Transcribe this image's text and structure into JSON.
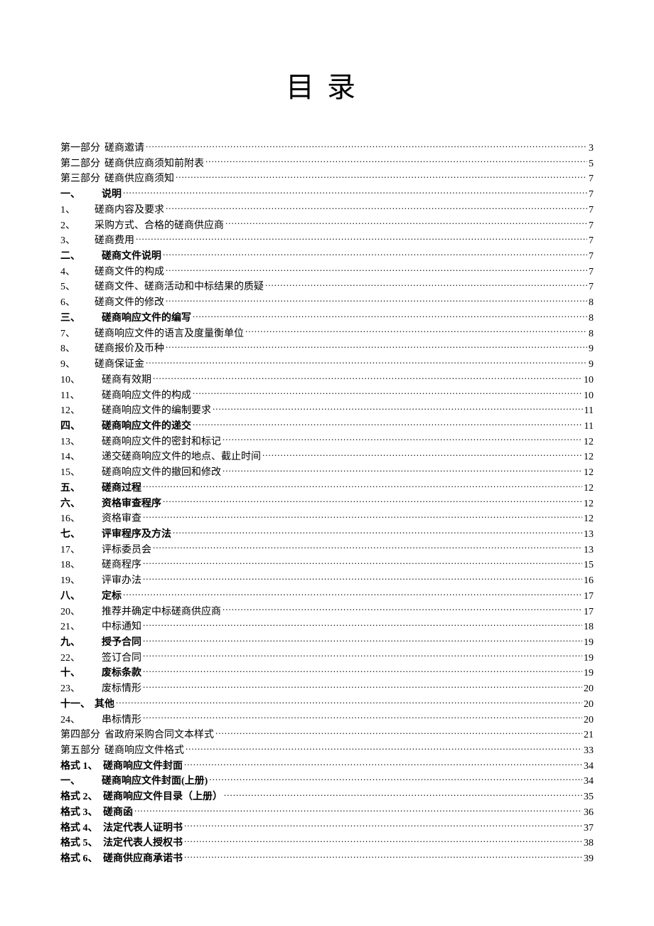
{
  "title": "目录",
  "entries": [
    {
      "num": "第一部分",
      "label": "磋商邀请",
      "page": "3",
      "boldLabel": false,
      "boldNum": false,
      "indent": false,
      "wide": true
    },
    {
      "num": "第二部分",
      "label": "磋商供应商须知前附表",
      "page": "5",
      "boldLabel": false,
      "boldNum": false,
      "indent": false,
      "wide": true
    },
    {
      "num": "第三部分",
      "label": "磋商供应商须知",
      "page": "7",
      "boldLabel": false,
      "boldNum": false,
      "indent": false,
      "wide": true
    },
    {
      "num": "一、",
      "label": "说明",
      "page": "7",
      "boldLabel": true,
      "boldNum": true,
      "indent": true,
      "wide": false
    },
    {
      "num": "1、",
      "label": "磋商内容及要求",
      "page": "7",
      "boldLabel": false,
      "boldNum": false,
      "indent": false,
      "wide": false
    },
    {
      "num": "2、",
      "label": "采购方式、合格的磋商供应商",
      "page": "7",
      "boldLabel": false,
      "boldNum": false,
      "indent": false,
      "wide": false
    },
    {
      "num": "3、",
      "label": "磋商费用",
      "page": "7",
      "boldLabel": false,
      "boldNum": false,
      "indent": false,
      "wide": false
    },
    {
      "num": "二、",
      "label": "磋商文件说明",
      "page": "7",
      "boldLabel": true,
      "boldNum": true,
      "indent": true,
      "wide": false
    },
    {
      "num": "4、",
      "label": "磋商文件的构成",
      "page": "7",
      "boldLabel": false,
      "boldNum": false,
      "indent": false,
      "wide": false
    },
    {
      "num": "5、",
      "label": "磋商文件、磋商活动和中标结果的质疑",
      "page": "7",
      "boldLabel": false,
      "boldNum": false,
      "indent": false,
      "wide": false
    },
    {
      "num": "6、",
      "label": "磋商文件的修改",
      "page": "8",
      "boldLabel": false,
      "boldNum": false,
      "indent": false,
      "wide": false
    },
    {
      "num": "三、",
      "label": "磋商响应文件的编写",
      "page": "8",
      "boldLabel": true,
      "boldNum": true,
      "indent": true,
      "wide": false
    },
    {
      "num": "7、",
      "label": "磋商响应文件的语言及度量衡单位",
      "page": "8",
      "boldLabel": false,
      "boldNum": false,
      "indent": false,
      "wide": false
    },
    {
      "num": "8、",
      "label": "磋商报价及币种",
      "page": "9",
      "boldLabel": false,
      "boldNum": false,
      "indent": false,
      "wide": false
    },
    {
      "num": "9、",
      "label": "磋商保证金",
      "page": "9",
      "boldLabel": false,
      "boldNum": false,
      "indent": false,
      "wide": false
    },
    {
      "num": "10、",
      "label": "磋商有效期",
      "page": "10",
      "boldLabel": false,
      "boldNum": false,
      "indent": true,
      "wide": false
    },
    {
      "num": "11、",
      "label": "磋商响应文件的构成",
      "page": "10",
      "boldLabel": false,
      "boldNum": false,
      "indent": true,
      "wide": false
    },
    {
      "num": "12、",
      "label": "磋商响应文件的编制要求",
      "page": "11",
      "boldLabel": false,
      "boldNum": false,
      "indent": true,
      "wide": false
    },
    {
      "num": "四、",
      "label": "磋商响应文件的递交",
      "page": "11",
      "boldLabel": true,
      "boldNum": true,
      "indent": true,
      "wide": false
    },
    {
      "num": "13、",
      "label": "磋商响应文件的密封和标记",
      "page": "12",
      "boldLabel": false,
      "boldNum": false,
      "indent": true,
      "wide": false
    },
    {
      "num": "14、",
      "label": "递交磋商响应文件的地点、截止时间",
      "page": "12",
      "boldLabel": false,
      "boldNum": false,
      "indent": true,
      "wide": false
    },
    {
      "num": "15、",
      "label": "磋商响应文件的撤回和修改",
      "page": "12",
      "boldLabel": false,
      "boldNum": false,
      "indent": true,
      "wide": false
    },
    {
      "num": "五、",
      "label": "磋商过程",
      "page": "12",
      "boldLabel": true,
      "boldNum": true,
      "indent": true,
      "wide": false
    },
    {
      "num": "六、",
      "label": "资格审查程序",
      "page": "12",
      "boldLabel": true,
      "boldNum": true,
      "indent": true,
      "wide": false
    },
    {
      "num": "16、",
      "label": "资格审查",
      "page": "12",
      "boldLabel": false,
      "boldNum": false,
      "indent": true,
      "wide": false
    },
    {
      "num": "七、",
      "label": "评审程序及方法",
      "page": "13",
      "boldLabel": true,
      "boldNum": true,
      "indent": true,
      "wide": false
    },
    {
      "num": "17、",
      "label": "评标委员会",
      "page": "13",
      "boldLabel": false,
      "boldNum": false,
      "indent": true,
      "wide": false
    },
    {
      "num": "18、",
      "label": "磋商程序",
      "page": "15",
      "boldLabel": false,
      "boldNum": false,
      "indent": true,
      "wide": false
    },
    {
      "num": "19、",
      "label": "评审办法",
      "page": "16",
      "boldLabel": false,
      "boldNum": false,
      "indent": true,
      "wide": false
    },
    {
      "num": "八、",
      "label": "定标",
      "page": "17",
      "boldLabel": true,
      "boldNum": true,
      "indent": true,
      "wide": false
    },
    {
      "num": "20、",
      "label": "推荐并确定中标磋商供应商",
      "page": "17",
      "boldLabel": false,
      "boldNum": false,
      "indent": true,
      "wide": false
    },
    {
      "num": "21、",
      "label": "中标通知",
      "page": "18",
      "boldLabel": false,
      "boldNum": false,
      "indent": true,
      "wide": false
    },
    {
      "num": "九、",
      "label": "授予合同",
      "page": "19",
      "boldLabel": true,
      "boldNum": true,
      "indent": true,
      "wide": false
    },
    {
      "num": "22、",
      "label": "签订合同",
      "page": "19",
      "boldLabel": false,
      "boldNum": false,
      "indent": true,
      "wide": false
    },
    {
      "num": "十、",
      "label": "废标条款",
      "page": "19",
      "boldLabel": true,
      "boldNum": true,
      "indent": true,
      "wide": false
    },
    {
      "num": "23、",
      "label": "废标情形",
      "page": "20",
      "boldLabel": false,
      "boldNum": false,
      "indent": true,
      "wide": false
    },
    {
      "num": "十一、",
      "label": "其他",
      "page": "20",
      "boldLabel": true,
      "boldNum": true,
      "indent": false,
      "wide": false
    },
    {
      "num": "24、",
      "label": "串标情形",
      "page": "20",
      "boldLabel": false,
      "boldNum": false,
      "indent": true,
      "wide": false
    },
    {
      "num": "第四部分",
      "label": "省政府采购合同文本样式",
      "page": "21",
      "boldLabel": false,
      "boldNum": false,
      "indent": false,
      "wide": true
    },
    {
      "num": "第五部分",
      "label": "磋商响应文件格式",
      "page": "33",
      "boldLabel": false,
      "boldNum": false,
      "indent": false,
      "wide": true
    },
    {
      "num": "格式 1、",
      "label": "磋商响应文件封面",
      "page": "34",
      "boldLabel": true,
      "boldNum": true,
      "indent": false,
      "wide": true
    },
    {
      "num": "一、",
      "label": "磋商响应文件封面(上册)",
      "page": "34",
      "boldLabel": true,
      "boldNum": true,
      "indent": true,
      "wide": false
    },
    {
      "num": "格式 2、",
      "label": "磋商响应文件目录（上册）",
      "page": "35",
      "boldLabel": true,
      "boldNum": true,
      "indent": false,
      "wide": true
    },
    {
      "num": "格式 3、",
      "label": "磋商函",
      "page": "36",
      "boldLabel": true,
      "boldNum": true,
      "indent": false,
      "wide": true
    },
    {
      "num": "格式 4、",
      "label": "法定代表人证明书",
      "page": "37",
      "boldLabel": true,
      "boldNum": true,
      "indent": false,
      "wide": true
    },
    {
      "num": "格式 5、",
      "label": "法定代表人授权书",
      "page": "38",
      "boldLabel": true,
      "boldNum": true,
      "indent": false,
      "wide": true
    },
    {
      "num": "格式 6、",
      "label": "磋商供应商承诺书",
      "page": "39",
      "boldLabel": true,
      "boldNum": true,
      "indent": false,
      "wide": true
    }
  ]
}
